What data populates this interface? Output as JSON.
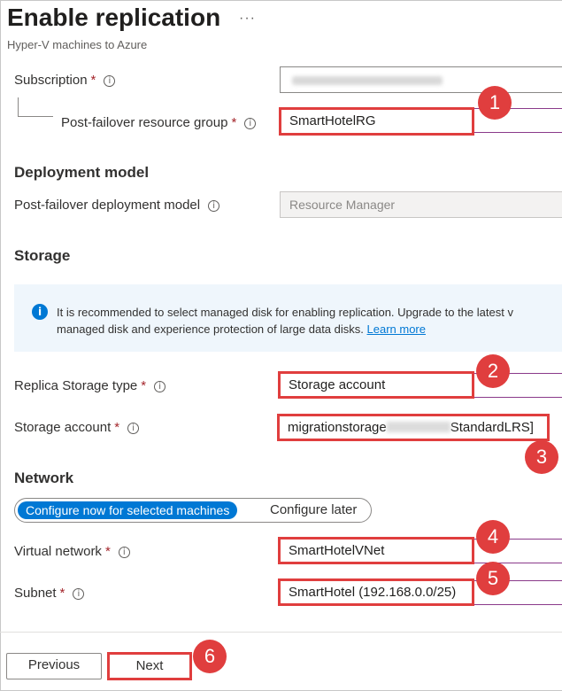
{
  "header": {
    "title": "Enable replication",
    "more": "···",
    "subtitle": "Hyper-V machines to Azure"
  },
  "fields": {
    "subscription_label": "Subscription",
    "resource_group_label": "Post-failover resource group",
    "resource_group_value": "SmartHotelRG",
    "deployment_model_label": "Post-failover deployment model",
    "deployment_model_value": "Resource Manager",
    "replica_storage_label": "Replica Storage type",
    "replica_storage_value": "Storage account",
    "storage_account_label": "Storage account",
    "storage_account_value_prefix": "migrationstorage",
    "storage_account_value_suffix": "StandardLRS]",
    "virtual_network_label": "Virtual network",
    "virtual_network_value": "SmartHotelVNet",
    "subnet_label": "Subnet",
    "subnet_value": "SmartHotel (192.168.0.0/25)"
  },
  "sections": {
    "deployment_model": "Deployment model",
    "storage": "Storage",
    "network": "Network"
  },
  "info": {
    "line1": "It is recommended to select managed disk for enabling replication. Upgrade to the latest v",
    "line2": "managed disk and experience protection of large data disks.",
    "link": "Learn more"
  },
  "network_toggle": {
    "selected": "Configure now for selected machines",
    "other": "Configure later"
  },
  "footer": {
    "previous": "Previous",
    "next": "Next"
  },
  "callouts": [
    "1",
    "2",
    "3",
    "4",
    "5",
    "6"
  ],
  "required_mark": "*",
  "info_icon": "i",
  "colors": {
    "accent": "#0078d4",
    "highlight": "#e03e3e",
    "required": "#a4262c"
  }
}
